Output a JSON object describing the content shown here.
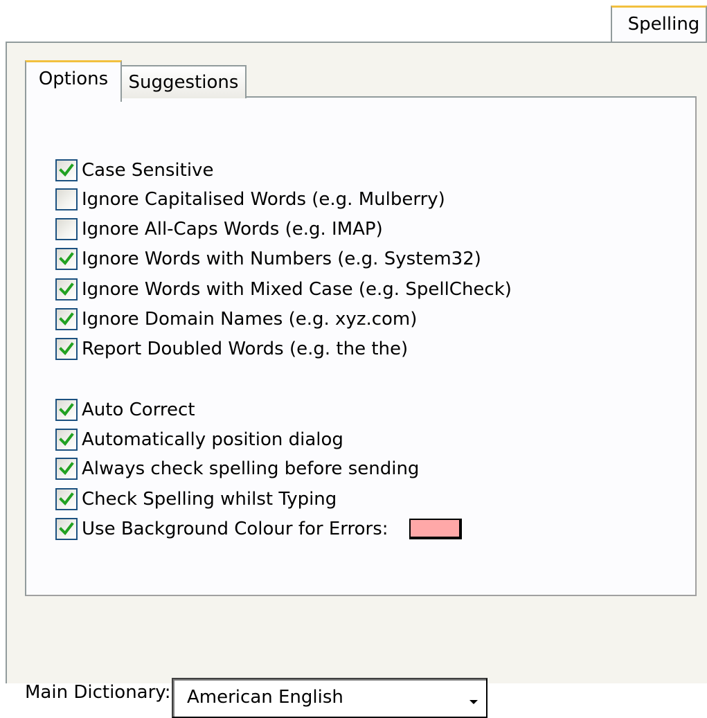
{
  "outer_tab": {
    "label": "Spelling"
  },
  "inner_tabs": [
    {
      "label": "Options",
      "active": true
    },
    {
      "label": "Suggestions",
      "active": false
    }
  ],
  "options": [
    {
      "label": "Case Sensitive",
      "checked": true
    },
    {
      "label": "Ignore Capitalised Words (e.g. Mulberry)",
      "checked": false
    },
    {
      "label": "Ignore All-Caps Words (e.g. IMAP)",
      "checked": false
    },
    {
      "label": "Ignore Words with Numbers (e.g. System32)",
      "checked": true
    },
    {
      "label": "Ignore Words with Mixed Case (e.g. SpellCheck)",
      "checked": true
    },
    {
      "label": "Ignore Domain Names (e.g. xyz.com)",
      "checked": true
    },
    {
      "label": "Report Doubled Words (e.g. the the)",
      "checked": true
    },
    {
      "label": "Auto Correct",
      "checked": true
    },
    {
      "label": "Automatically position dialog",
      "checked": true
    },
    {
      "label": "Always check spelling before sending",
      "checked": true
    },
    {
      "label": "Check Spelling whilst Typing",
      "checked": true
    },
    {
      "label": "Use Background Colour for Errors:",
      "checked": true
    }
  ],
  "error_colour": "#ffa8a8",
  "check_colour": "#21a121",
  "dictionary": {
    "label": "Main Dictionary:",
    "value": "American English"
  }
}
